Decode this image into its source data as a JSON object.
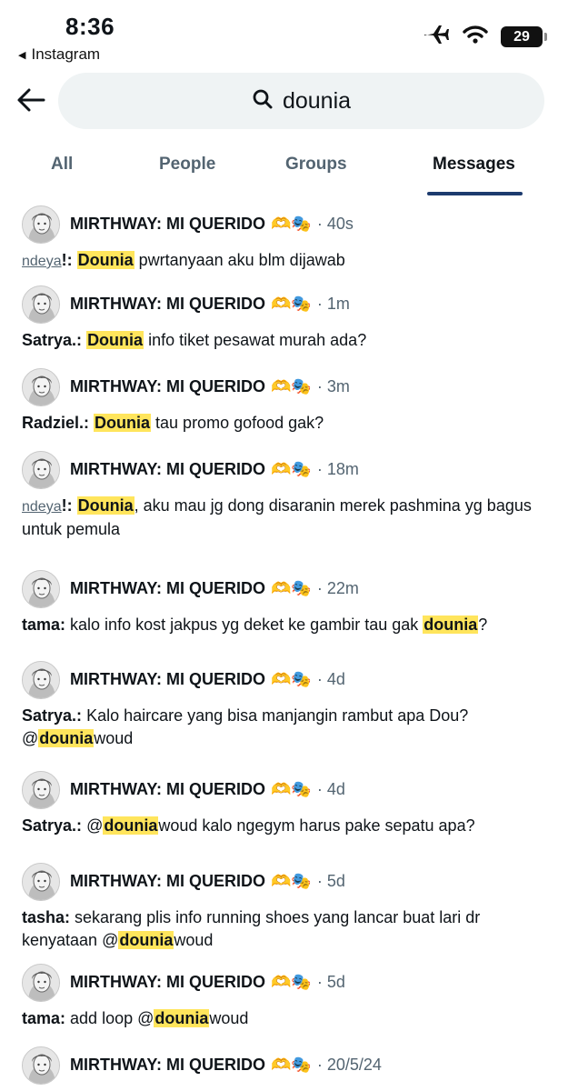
{
  "status": {
    "time": "8:36",
    "back_app": "Instagram",
    "battery": "29",
    "icons": [
      "airplane-icon",
      "wifi-icon",
      "battery-icon"
    ]
  },
  "search": {
    "query": "dounia"
  },
  "tabs": [
    {
      "label": "All",
      "active": false
    },
    {
      "label": "People",
      "active": false
    },
    {
      "label": "Groups",
      "active": false
    },
    {
      "label": "Messages",
      "active": true
    }
  ],
  "colors": {
    "highlight": "#ffe55c",
    "tab_underline": "#1d3b6e",
    "muted": "#536471"
  },
  "results": [
    {
      "group": "MIRTHWAY: MI QUERIDO",
      "emoji": "🫶🎭",
      "time": "· 40s",
      "sender": "ndeya",
      "sender_suffix": "!: ",
      "pre": "",
      "match": "Dounia",
      "post": " pwrtanyaan aku blm dijawab"
    },
    {
      "group": "MIRTHWAY: MI QUERIDO",
      "emoji": "🫶🎭",
      "time": "· 1m",
      "sender": "Satrya.:",
      "sender_suffix": " ",
      "pre": "",
      "match": "Dounia",
      "post": " info tiket pesawat murah ada?"
    },
    {
      "group": "MIRTHWAY: MI QUERIDO",
      "emoji": "🫶🎭",
      "time": "· 3m",
      "sender": "Radziel.:",
      "sender_suffix": " ",
      "pre": "",
      "match": "Dounia",
      "post": " tau promo gofood gak?"
    },
    {
      "group": "MIRTHWAY: MI QUERIDO",
      "emoji": "🫶🎭",
      "time": "· 18m",
      "sender": "ndeya",
      "sender_suffix": "!: ",
      "pre": "",
      "match": "Dounia",
      "post": ", aku mau jg dong disaranin merek pashmina yg bagus untuk pemula"
    },
    {
      "group": "MIRTHWAY: MI QUERIDO",
      "emoji": "🫶🎭",
      "time": "· 22m",
      "sender": "tama:",
      "sender_suffix": " ",
      "pre": "kalo info kost jakpus yg deket ke gambir tau gak ",
      "match": "dounia",
      "post": "?"
    },
    {
      "group": "MIRTHWAY: MI QUERIDO",
      "emoji": "🫶🎭",
      "time": "· 4d",
      "sender": "Satrya.:",
      "sender_suffix": " ",
      "pre": "Kalo haircare yang bisa manjangin rambut apa Dou? @",
      "match": "dounia",
      "post": "woud"
    },
    {
      "group": "MIRTHWAY: MI QUERIDO",
      "emoji": "🫶🎭",
      "time": "· 4d",
      "sender": "Satrya.:",
      "sender_suffix": " ",
      "pre": "@",
      "match": "dounia",
      "post": "woud kalo ngegym harus pake sepatu apa?"
    },
    {
      "group": "MIRTHWAY: MI QUERIDO",
      "emoji": "🫶🎭",
      "time": "· 5d",
      "sender": "tasha:",
      "sender_suffix": " ",
      "pre": "sekarang plis info running shoes yang lancar buat lari dr kenyataan @",
      "match": "dounia",
      "post": "woud"
    },
    {
      "group": "MIRTHWAY: MI QUERIDO",
      "emoji": "🫶🎭",
      "time": "· 5d",
      "sender": "tama:",
      "sender_suffix": " ",
      "pre": "add loop @",
      "match": "dounia",
      "post": "woud"
    },
    {
      "group": "MIRTHWAY: MI QUERIDO",
      "emoji": "🫶🎭",
      "time": "· 20/5/24",
      "sender": "",
      "sender_suffix": "",
      "pre": "",
      "match": "",
      "post": ""
    }
  ]
}
